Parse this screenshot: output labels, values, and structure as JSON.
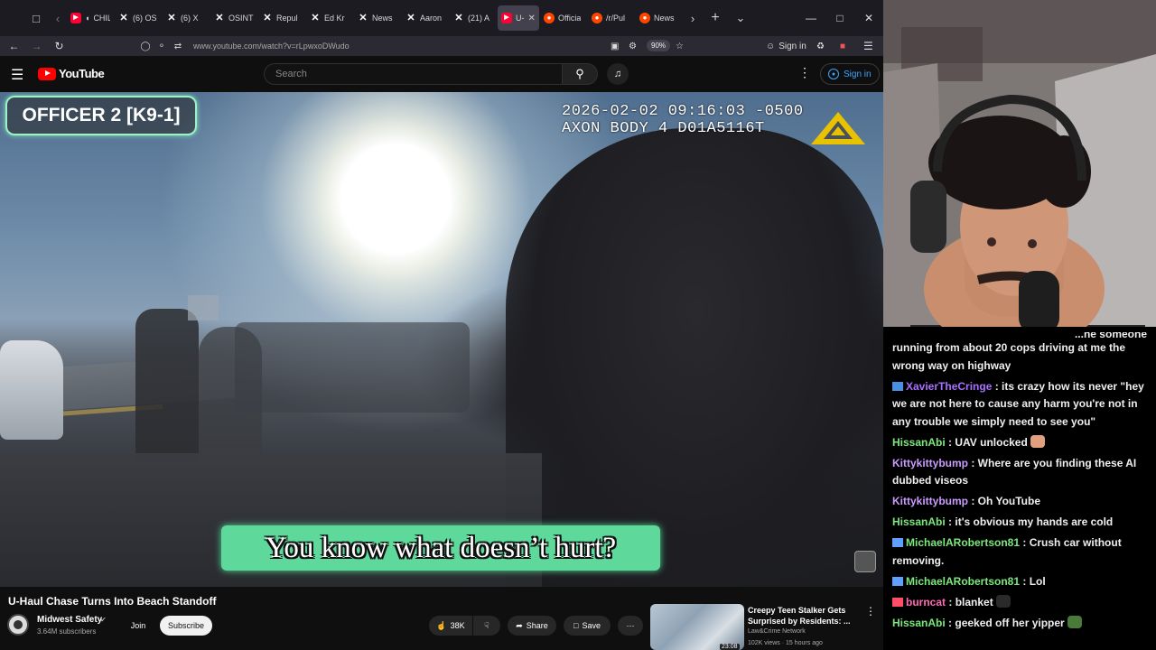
{
  "browser": {
    "tabs": [
      {
        "label": "CHILL",
        "icon": "youtube",
        "audio": true
      },
      {
        "label": "(6) OS",
        "icon": "x"
      },
      {
        "label": "(6) X",
        "icon": "x"
      },
      {
        "label": "OSINT",
        "icon": "x"
      },
      {
        "label": "Repul",
        "icon": "x"
      },
      {
        "label": "Ed Kr",
        "icon": "x"
      },
      {
        "label": "News",
        "icon": "x"
      },
      {
        "label": "Aaron",
        "icon": "x"
      },
      {
        "label": "(21) A",
        "icon": "x"
      },
      {
        "label": "U-",
        "icon": "youtube",
        "active": true
      },
      {
        "label": "Officia",
        "icon": "reddit"
      },
      {
        "label": "/r/Pul",
        "icon": "reddit"
      },
      {
        "label": "News",
        "icon": "reddit"
      }
    ],
    "url": "www.youtube.com/watch?v=rLpwxoDWudo",
    "zoom": "90%",
    "signin_label": "Sign in"
  },
  "youtube": {
    "logo_text": "YouTube",
    "search_placeholder": "Search",
    "signin_label": "Sign in"
  },
  "video": {
    "officer_label": "OFFICER 2 [K9-1]",
    "timestamp_line1": "2026-02-02 09:16:03 -0500",
    "timestamp_line2": "AXON BODY 4 D01A5116T",
    "caption": "You know what doesn’t hurt?"
  },
  "below_video": {
    "title": "U-Haul Chase Turns Into Beach Standoff",
    "channel": "Midwest Safety",
    "subscribers": "3.64M subscribers",
    "join_label": "Join",
    "subscribe_label": "Subscribe",
    "likes": "38K",
    "share_label": "Share",
    "save_label": "Save"
  },
  "related": {
    "title": "Creepy Teen Stalker Gets Surprised by Residents: ...",
    "channel": "Law&Crime Network",
    "meta": "102K views · 15 hours ago",
    "duration": "23:08"
  },
  "chat": {
    "messages": [
      {
        "user": "",
        "color": "#efeff1",
        "text": "running from about 20 cops driving at me the wrong way on highway",
        "partial": "...ne someone"
      },
      {
        "user": "XavierTheCringe",
        "color": "#a970ff",
        "badge": "#4a90e2",
        "text": "its crazy how its never \"hey we are not here to cause any harm you're not in any trouble we simply need to see you\""
      },
      {
        "user": "HissanAbi",
        "color": "#7ce87c",
        "text": "UAV unlocked",
        "emote": "#e0a080"
      },
      {
        "user": "Kittykittybump",
        "color": "#c99cff",
        "text": "Where are you finding these AI dubbed viseos"
      },
      {
        "user": "Kittykittybump",
        "color": "#c99cff",
        "text": "Oh YouTube"
      },
      {
        "user": "HissanAbi",
        "color": "#7ce87c",
        "text": "it's obvious my hands are cold"
      },
      {
        "user": "MichaelARobertson81",
        "color": "#7ce87c",
        "badge": "#5fa0ff",
        "text": "Crush car without removing."
      },
      {
        "user": "MichaelARobertson81",
        "color": "#7ce87c",
        "badge": "#5fa0ff",
        "text": "Lol"
      },
      {
        "user": "burncat",
        "color": "#ff69b4",
        "badge": "#ff4d6a",
        "text": "blanket",
        "emote": "#2a2a2a"
      },
      {
        "user": "HissanAbi",
        "color": "#7ce87c",
        "text": "geeked off her yipper",
        "emote": "#4a7a3a"
      }
    ]
  }
}
